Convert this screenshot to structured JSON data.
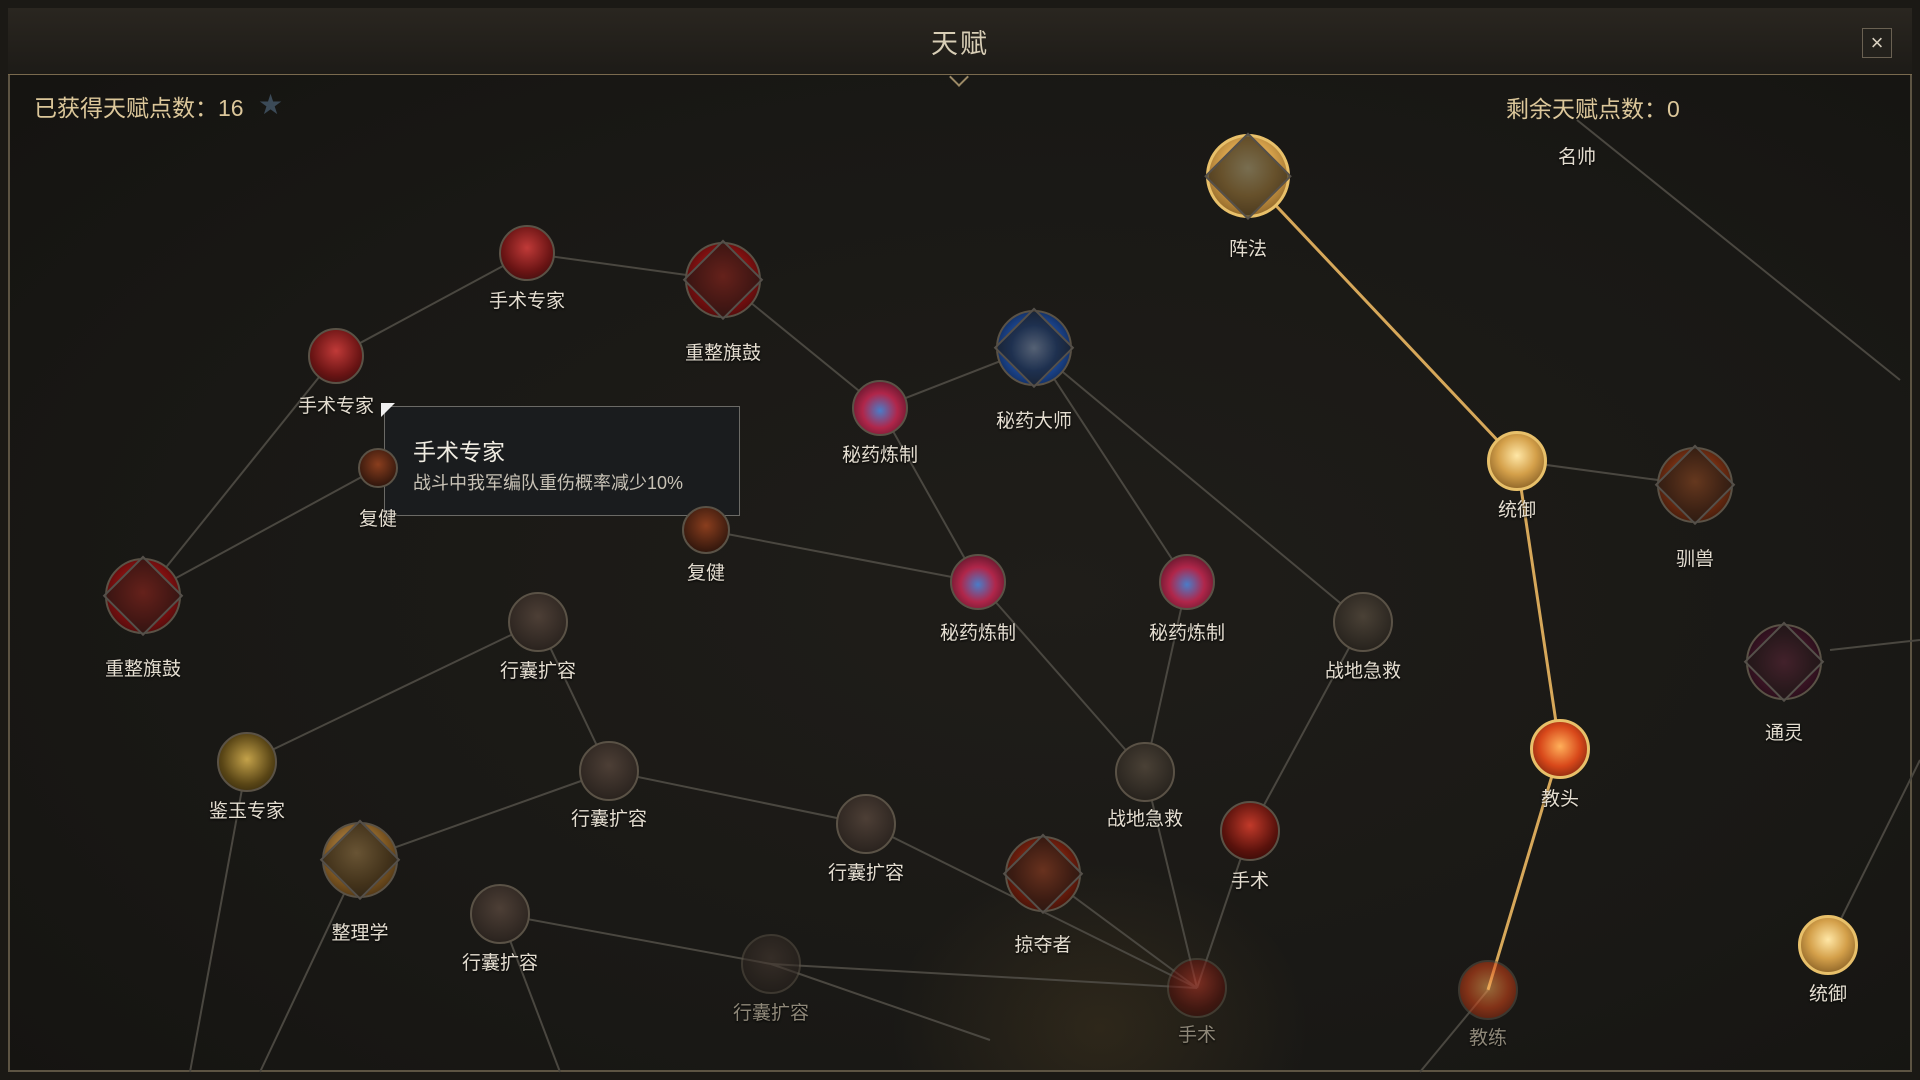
{
  "window": {
    "title": "天赋",
    "close_label": "×"
  },
  "points": {
    "earned": "已获得天赋点数：16",
    "remaining": "剩余天赋点数：0"
  },
  "tooltip": {
    "title": "手术专家",
    "description": "战斗中我军编队重伤概率减少10%"
  },
  "colors": {
    "active_path": "#d7a85a",
    "inactive_path": "#4a4740",
    "gold": "#dcc79a"
  },
  "nodes": [
    {
      "label": "手术专家",
      "icon": "scalpel-icon",
      "state": "inactive"
    },
    {
      "label": "重整旗鼓",
      "icon": "heart-icon",
      "state": "inactive"
    },
    {
      "label": "手术专家",
      "icon": "scalpel-icon",
      "state": "inactive"
    },
    {
      "label": "复健",
      "icon": "recovery-icon",
      "state": "inactive"
    },
    {
      "label": "重整旗鼓",
      "icon": "heart-icon",
      "state": "inactive"
    },
    {
      "label": "复健",
      "icon": "recovery-icon",
      "state": "inactive"
    },
    {
      "label": "秘药炼制",
      "icon": "potion-icon",
      "state": "inactive"
    },
    {
      "label": "秘药大师",
      "icon": "elixir-master-icon",
      "state": "inactive"
    },
    {
      "label": "秘药炼制",
      "icon": "potion-icon",
      "state": "inactive"
    },
    {
      "label": "秘药炼制",
      "icon": "potion-icon",
      "state": "inactive"
    },
    {
      "label": "战地急救",
      "icon": "bandage-icon",
      "state": "inactive"
    },
    {
      "label": "行囊扩容",
      "icon": "bag-icon",
      "state": "inactive"
    },
    {
      "label": "鉴玉专家",
      "icon": "jade-icon",
      "state": "inactive"
    },
    {
      "label": "行囊扩容",
      "icon": "bag-icon",
      "state": "inactive"
    },
    {
      "label": "行囊扩容",
      "icon": "bag-icon",
      "state": "inactive"
    },
    {
      "label": "整理学",
      "icon": "scroll-icon",
      "state": "inactive"
    },
    {
      "label": "行囊扩容",
      "icon": "bag-icon",
      "state": "inactive"
    },
    {
      "label": "行囊扩容",
      "icon": "bag-icon",
      "state": "dim"
    },
    {
      "label": "战地急救",
      "icon": "bandage-icon",
      "state": "inactive"
    },
    {
      "label": "掠夺者",
      "icon": "raider-icon",
      "state": "inactive"
    },
    {
      "label": "手术",
      "icon": "surgery-icon",
      "state": "inactive"
    },
    {
      "label": "手术",
      "icon": "surgery-icon",
      "state": "dim"
    },
    {
      "label": "阵法",
      "icon": "formation-icon",
      "state": "active"
    },
    {
      "label": "统御",
      "icon": "commander-icon",
      "state": "active"
    },
    {
      "label": "驯兽",
      "icon": "beast-icon",
      "state": "inactive"
    },
    {
      "label": "通灵",
      "icon": "spirit-icon",
      "state": "inactive"
    },
    {
      "label": "教头",
      "icon": "drill-icon",
      "state": "active"
    },
    {
      "label": "教练",
      "icon": "drill-icon",
      "state": "dim"
    },
    {
      "label": "统御",
      "icon": "commander-icon",
      "state": "active"
    },
    {
      "label": "名帅",
      "icon": "",
      "state": "inactive"
    }
  ]
}
